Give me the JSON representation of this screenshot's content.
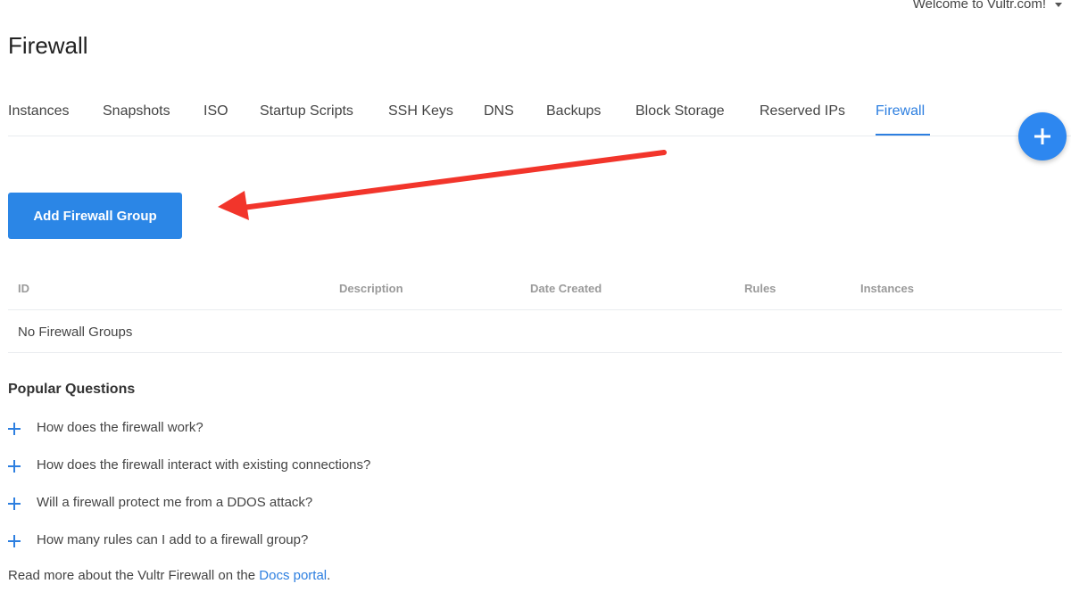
{
  "header": {
    "welcome": "Welcome to Vultr.com!",
    "title": "Firewall"
  },
  "tabs": [
    {
      "label": "Instances"
    },
    {
      "label": "Snapshots"
    },
    {
      "label": "ISO"
    },
    {
      "label": "Startup Scripts"
    },
    {
      "label": "SSH Keys"
    },
    {
      "label": "DNS"
    },
    {
      "label": "Backups"
    },
    {
      "label": "Block Storage"
    },
    {
      "label": "Reserved IPs"
    },
    {
      "label": "Firewall",
      "active": true
    }
  ],
  "actions": {
    "add_label": "Add Firewall Group",
    "fab_icon": "plus-icon"
  },
  "table": {
    "columns": [
      "ID",
      "Description",
      "Date Created",
      "Rules",
      "Instances"
    ],
    "empty_message": "No Firewall Groups"
  },
  "faq": {
    "title": "Popular Questions",
    "items": [
      "How does the firewall work?",
      "How does the firewall interact with existing connections?",
      "Will a firewall protect me from a DDOS attack?",
      "How many rules can I add to a firewall group?"
    ]
  },
  "docs": {
    "prefix": "Read more about the Vultr Firewall on the ",
    "link": "Docs portal",
    "suffix": "."
  },
  "colors": {
    "accent": "#2d7fe0",
    "button": "#2b86e6",
    "annotation_arrow": "#f2352b"
  }
}
